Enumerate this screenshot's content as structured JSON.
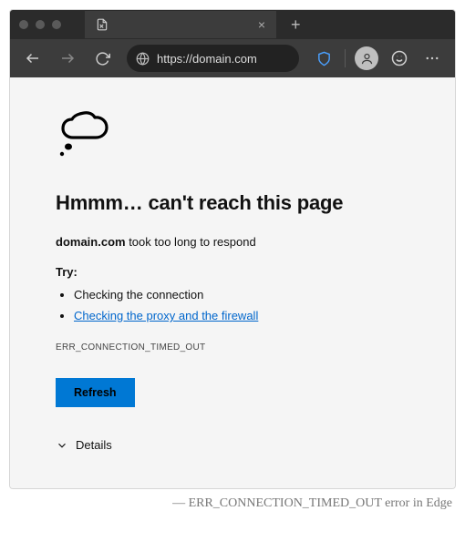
{
  "toolbar": {
    "url": "https://domain.com"
  },
  "error": {
    "heading": "Hmmm… can't reach this page",
    "domain": "domain.com",
    "desc_tail": " took too long to respond",
    "try_label": "Try:",
    "suggestions": {
      "plain": "Checking the connection",
      "link": "Checking the proxy and the firewall"
    },
    "code": "ERR_CONNECTION_TIMED_OUT",
    "refresh_label": "Refresh",
    "details_label": "Details"
  },
  "caption": "— ERR_CONNECTION_TIMED_OUT error in Edge"
}
